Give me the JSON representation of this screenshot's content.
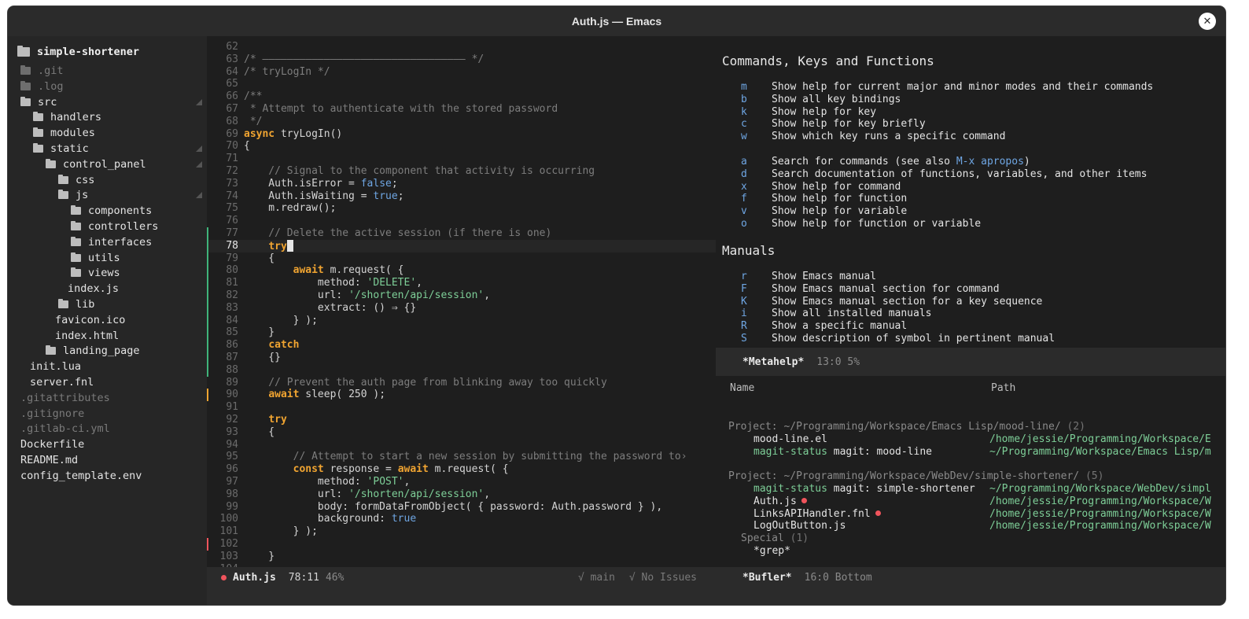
{
  "window": {
    "title": "Auth.js — Emacs",
    "close_icon": "✕"
  },
  "sidebar": {
    "root": "simple-shortener",
    "items": [
      {
        "label": ".git",
        "type": "folder",
        "indent": 0,
        "dim": true
      },
      {
        "label": ".log",
        "type": "folder",
        "indent": 0,
        "dim": true
      },
      {
        "label": "src",
        "type": "folder",
        "indent": 0,
        "dim": false,
        "expander": true
      },
      {
        "label": "handlers",
        "type": "folder",
        "indent": 1
      },
      {
        "label": "modules",
        "type": "folder",
        "indent": 1
      },
      {
        "label": "static",
        "type": "folder",
        "indent": 1,
        "expander": true
      },
      {
        "label": "control_panel",
        "type": "folder",
        "indent": 2,
        "expander": true
      },
      {
        "label": "css",
        "type": "folder",
        "indent": 3
      },
      {
        "label": "js",
        "type": "folder",
        "indent": 3,
        "expander": true
      },
      {
        "label": "components",
        "type": "folder",
        "indent": 4
      },
      {
        "label": "controllers",
        "type": "folder",
        "indent": 4
      },
      {
        "label": "interfaces",
        "type": "folder",
        "indent": 4
      },
      {
        "label": "utils",
        "type": "folder",
        "indent": 4
      },
      {
        "label": "views",
        "type": "folder",
        "indent": 4
      },
      {
        "label": "index.js",
        "type": "file",
        "indent": 4
      },
      {
        "label": "lib",
        "type": "folder",
        "indent": 3
      },
      {
        "label": "favicon.ico",
        "type": "file",
        "indent": 3
      },
      {
        "label": "index.html",
        "type": "file",
        "indent": 3
      },
      {
        "label": "landing_page",
        "type": "folder",
        "indent": 2
      },
      {
        "label": "init.lua",
        "type": "file",
        "indent": 1
      },
      {
        "label": "server.fnl",
        "type": "file",
        "indent": 1
      },
      {
        "label": ".gitattributes",
        "type": "file",
        "indent": 0,
        "dim": true
      },
      {
        "label": ".gitignore",
        "type": "file",
        "indent": 0,
        "dim": true
      },
      {
        "label": ".gitlab-ci.yml",
        "type": "file",
        "indent": 0,
        "dim": true
      },
      {
        "label": "Dockerfile",
        "type": "file",
        "indent": 0
      },
      {
        "label": "README.md",
        "type": "file",
        "indent": 0
      },
      {
        "label": "config_template.env",
        "type": "file",
        "indent": 0
      }
    ]
  },
  "editor": {
    "current_line": 78,
    "lines": [
      {
        "n": 62,
        "t": ""
      },
      {
        "n": 63,
        "segs": [
          [
            "cm",
            "/* ————————————————————————————————— */"
          ]
        ]
      },
      {
        "n": 64,
        "segs": [
          [
            "cm",
            "/* tryLogIn */"
          ]
        ]
      },
      {
        "n": 65,
        "t": ""
      },
      {
        "n": 66,
        "segs": [
          [
            "cm",
            "/**"
          ]
        ]
      },
      {
        "n": 67,
        "segs": [
          [
            "cm",
            " * Attempt to authenticate with the stored password"
          ]
        ]
      },
      {
        "n": 68,
        "segs": [
          [
            "cm",
            " */"
          ]
        ]
      },
      {
        "n": 69,
        "segs": [
          [
            "kw",
            "async"
          ],
          [
            "",
            " tryLogIn()"
          ]
        ]
      },
      {
        "n": 70,
        "segs": [
          [
            "",
            "{"
          ]
        ]
      },
      {
        "n": 71,
        "t": ""
      },
      {
        "n": 72,
        "segs": [
          [
            "cm",
            "    // Signal to the component that activity is occurring"
          ]
        ]
      },
      {
        "n": 73,
        "segs": [
          [
            "",
            "    Auth.isError = "
          ],
          [
            "bl",
            "false"
          ],
          [
            "",
            ";"
          ]
        ]
      },
      {
        "n": 74,
        "segs": [
          [
            "",
            "    Auth.isWaiting = "
          ],
          [
            "bl",
            "true"
          ],
          [
            "",
            ";"
          ]
        ]
      },
      {
        "n": 75,
        "segs": [
          [
            "",
            "    m.redraw();"
          ]
        ]
      },
      {
        "n": 76,
        "t": ""
      },
      {
        "n": 77,
        "segs": [
          [
            "cm",
            "    // Delete the active session (if there is one)"
          ]
        ]
      },
      {
        "n": 78,
        "segs": [
          [
            "",
            "    "
          ],
          [
            "kw",
            "try"
          ]
        ],
        "cursor": true
      },
      {
        "n": 79,
        "segs": [
          [
            "",
            "    {"
          ]
        ]
      },
      {
        "n": 80,
        "segs": [
          [
            "",
            "        "
          ],
          [
            "kw",
            "await"
          ],
          [
            "",
            " m.request( {"
          ]
        ]
      },
      {
        "n": 81,
        "segs": [
          [
            "",
            "            method: "
          ],
          [
            "st",
            "'DELETE'"
          ],
          [
            "",
            ","
          ]
        ]
      },
      {
        "n": 82,
        "segs": [
          [
            "",
            "            url: "
          ],
          [
            "st",
            "'/shorten/api/session'"
          ],
          [
            "",
            ","
          ]
        ]
      },
      {
        "n": 83,
        "segs": [
          [
            "",
            "            extract: () ⇒ {}"
          ]
        ]
      },
      {
        "n": 84,
        "segs": [
          [
            "",
            "        } );"
          ]
        ]
      },
      {
        "n": 85,
        "segs": [
          [
            "",
            "    }"
          ]
        ]
      },
      {
        "n": 86,
        "segs": [
          [
            "",
            "    "
          ],
          [
            "kw",
            "catch"
          ]
        ]
      },
      {
        "n": 87,
        "segs": [
          [
            "",
            "    {}"
          ]
        ]
      },
      {
        "n": 88,
        "t": ""
      },
      {
        "n": 89,
        "segs": [
          [
            "cm",
            "    // Prevent the auth page from blinking away too quickly"
          ]
        ]
      },
      {
        "n": 90,
        "segs": [
          [
            "",
            "    "
          ],
          [
            "kw",
            "await"
          ],
          [
            "",
            " sleep( 250 );"
          ]
        ]
      },
      {
        "n": 91,
        "t": ""
      },
      {
        "n": 92,
        "segs": [
          [
            "",
            "    "
          ],
          [
            "kw",
            "try"
          ]
        ]
      },
      {
        "n": 93,
        "segs": [
          [
            "",
            "    {"
          ]
        ]
      },
      {
        "n": 94,
        "t": ""
      },
      {
        "n": 95,
        "segs": [
          [
            "cm",
            "        // Attempt to start a new session by submitting the password to›"
          ]
        ]
      },
      {
        "n": 96,
        "segs": [
          [
            "",
            "        "
          ],
          [
            "kw",
            "const"
          ],
          [
            "",
            " response = "
          ],
          [
            "kw",
            "await"
          ],
          [
            "",
            " m.request( {"
          ]
        ]
      },
      {
        "n": 97,
        "segs": [
          [
            "",
            "            method: "
          ],
          [
            "st",
            "'POST'"
          ],
          [
            "",
            ","
          ]
        ]
      },
      {
        "n": 98,
        "segs": [
          [
            "",
            "            url: "
          ],
          [
            "st",
            "'/shorten/api/session'"
          ],
          [
            "",
            ","
          ]
        ]
      },
      {
        "n": 99,
        "segs": [
          [
            "",
            "            body: formDataFromObject( { password: Auth.password } ),"
          ]
        ]
      },
      {
        "n": 100,
        "segs": [
          [
            "",
            "            background: "
          ],
          [
            "bl",
            "true"
          ]
        ]
      },
      {
        "n": 101,
        "segs": [
          [
            "",
            "        } );"
          ]
        ]
      },
      {
        "n": 102,
        "t": ""
      },
      {
        "n": 103,
        "segs": [
          [
            "",
            "    }"
          ]
        ]
      },
      {
        "n": 104,
        "t": ""
      }
    ],
    "gutter_marks": [
      {
        "from": 77,
        "to": 88,
        "color": "#3fb37a"
      },
      {
        "from": 90,
        "to": 90,
        "color": "#f0a431"
      },
      {
        "from": 102,
        "to": 102,
        "color": "#f0545c"
      }
    ],
    "modeline": {
      "file": "Auth.js",
      "position": "78:11",
      "percent": "46%",
      "branch": "√ main",
      "issues": "√ No Issues"
    }
  },
  "help": {
    "heading1": "Commands, Keys and Functions",
    "group1": [
      {
        "key": "m",
        "desc": "Show help for current major and minor modes and their commands"
      },
      {
        "key": "b",
        "desc": "Show all key bindings"
      },
      {
        "key": "k",
        "desc": "Show help for key"
      },
      {
        "key": "c",
        "desc": "Show help for key briefly"
      },
      {
        "key": "w",
        "desc": "Show which key runs a specific command"
      }
    ],
    "group2": [
      {
        "key": "a",
        "desc": "Search for commands (see also ",
        "link": "M-x apropos",
        "after": ")"
      },
      {
        "key": "d",
        "desc": "Search documentation of functions, variables, and other items"
      },
      {
        "key": "x",
        "desc": "Show help for command"
      },
      {
        "key": "f",
        "desc": "Show help for function"
      },
      {
        "key": "v",
        "desc": "Show help for variable"
      },
      {
        "key": "o",
        "desc": "Show help for function or variable"
      }
    ],
    "heading2": "Manuals",
    "group3": [
      {
        "key": "r",
        "desc": "Show Emacs manual"
      },
      {
        "key": "F",
        "desc": "Show Emacs manual section for command"
      },
      {
        "key": "K",
        "desc": "Show Emacs manual section for a key sequence"
      },
      {
        "key": "i",
        "desc": "Show all installed manuals"
      },
      {
        "key": "R",
        "desc": "Show a specific manual"
      },
      {
        "key": "S",
        "desc": "Show description of symbol in pertinent manual"
      }
    ],
    "modeline": {
      "buffer": "*Metahelp*",
      "position": "13:0 5%"
    }
  },
  "bufler": {
    "columns": {
      "name": "Name",
      "path": "Path"
    },
    "groups": [
      {
        "title": "Project: ~/Programming/Workspace/Emacs Lisp/mood-line/",
        "count": "(2)",
        "rows": [
          {
            "name": "mood-line.el",
            "name_style": "white",
            "path": "/home/jessie/Programming/Workspace/E"
          },
          {
            "name": "magit-status",
            "name_extra": " magit: mood-line",
            "name_style": "green",
            "path": "~/Programming/Workspace/Emacs Lisp/m"
          }
        ]
      },
      {
        "title": "Project: ~/Programming/Workspace/WebDev/simple-shortener/",
        "count": "(5)",
        "rows": [
          {
            "name": "magit-status",
            "name_extra": " magit: simple-shortener",
            "name_style": "green",
            "path": "~/Programming/Workspace/WebDev/simpl"
          },
          {
            "name": "Auth.js",
            "name_style": "white",
            "modified": true,
            "path": "/home/jessie/Programming/Workspace/W"
          },
          {
            "name": "LinksAPIHandler.fnl",
            "name_style": "white",
            "modified": true,
            "path": "/home/jessie/Programming/Workspace/W"
          },
          {
            "name": "LogOutButton.js",
            "name_style": "white",
            "path": "/home/jessie/Programming/Workspace/W"
          }
        ]
      }
    ],
    "special": {
      "title": "Special",
      "count": "(1)",
      "item": "*grep*"
    },
    "modeline": {
      "buffer": "*Bufler*",
      "position": "16:0 Bottom"
    }
  }
}
